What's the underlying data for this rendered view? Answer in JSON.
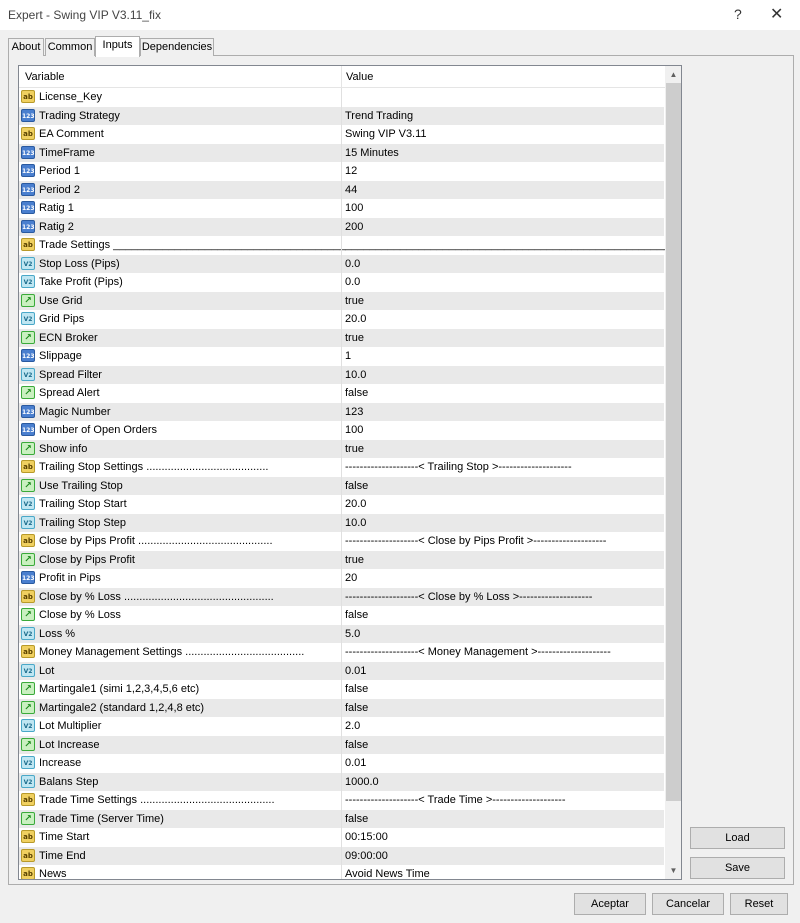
{
  "window": {
    "title": "Expert - Swing VIP V3.11_fix",
    "help": "?",
    "close": "✕"
  },
  "tabs": [
    "About",
    "Common",
    "Inputs",
    "Dependencies"
  ],
  "grid": {
    "headers": {
      "variable": "Variable",
      "value": "Value"
    },
    "rows": [
      {
        "icon": "ab",
        "variable": "License_Key",
        "value": ""
      },
      {
        "icon": "int",
        "variable": "Trading Strategy",
        "value": "Trend Trading"
      },
      {
        "icon": "ab",
        "variable": "EA Comment",
        "value": "Swing VIP V3.11"
      },
      {
        "icon": "int",
        "variable": "TimeFrame",
        "value": "15 Minutes"
      },
      {
        "icon": "int",
        "variable": "Period 1",
        "value": "12"
      },
      {
        "icon": "int",
        "variable": "Period 2",
        "value": "44"
      },
      {
        "icon": "int",
        "variable": "Ratig 1",
        "value": "100"
      },
      {
        "icon": "int",
        "variable": "Ratig 2",
        "value": "200"
      },
      {
        "icon": "ab",
        "variable": "Trade Settings ______________________________________",
        "value": "______________________________________________________"
      },
      {
        "icon": "dbl",
        "variable": "Stop Loss (Pips)",
        "value": "0.0"
      },
      {
        "icon": "dbl",
        "variable": "Take Profit (Pips)",
        "value": "0.0"
      },
      {
        "icon": "bool",
        "variable": "Use Grid",
        "value": "true"
      },
      {
        "icon": "dbl",
        "variable": "Grid Pips",
        "value": "20.0"
      },
      {
        "icon": "bool",
        "variable": "ECN Broker",
        "value": "true"
      },
      {
        "icon": "int",
        "variable": "Slippage",
        "value": "1"
      },
      {
        "icon": "dbl",
        "variable": "Spread Filter",
        "value": "10.0"
      },
      {
        "icon": "bool",
        "variable": "Spread Alert",
        "value": "false"
      },
      {
        "icon": "int",
        "variable": "Magic Number",
        "value": "123"
      },
      {
        "icon": "int",
        "variable": "Number of Open Orders",
        "value": "100"
      },
      {
        "icon": "bool",
        "variable": "Show info",
        "value": "true"
      },
      {
        "icon": "ab",
        "variable": "Trailing Stop Settings ........................................",
        "value": "--------------------< Trailing Stop >--------------------"
      },
      {
        "icon": "bool",
        "variable": "Use Trailing Stop",
        "value": "false"
      },
      {
        "icon": "dbl",
        "variable": "Trailing Stop Start",
        "value": "20.0"
      },
      {
        "icon": "dbl",
        "variable": "Trailing Stop Step",
        "value": "10.0"
      },
      {
        "icon": "ab",
        "variable": "Close by Pips Profit ............................................",
        "value": "--------------------< Close by Pips Profit >--------------------"
      },
      {
        "icon": "bool",
        "variable": "Close by Pips Profit",
        "value": "true"
      },
      {
        "icon": "int",
        "variable": "Profit in Pips",
        "value": "20"
      },
      {
        "icon": "ab",
        "variable": "Close by % Loss .................................................",
        "value": "--------------------< Close by % Loss >--------------------"
      },
      {
        "icon": "bool",
        "variable": "Close by % Loss",
        "value": "false"
      },
      {
        "icon": "dbl",
        "variable": "Loss %",
        "value": "5.0"
      },
      {
        "icon": "ab",
        "variable": "Money Management Settings .......................................",
        "value": "--------------------< Money Management >--------------------"
      },
      {
        "icon": "dbl",
        "variable": "Lot",
        "value": "0.01"
      },
      {
        "icon": "bool",
        "variable": "Martingale1 (simi 1,2,3,4,5,6 etc)",
        "value": "false"
      },
      {
        "icon": "bool",
        "variable": "Martingale2 (standard 1,2,4,8 etc)",
        "value": "false"
      },
      {
        "icon": "dbl",
        "variable": "Lot Multiplier",
        "value": "2.0"
      },
      {
        "icon": "bool",
        "variable": "Lot Increase",
        "value": "false"
      },
      {
        "icon": "dbl",
        "variable": "Increase",
        "value": "0.01"
      },
      {
        "icon": "dbl",
        "variable": "Balans Step",
        "value": "1000.0"
      },
      {
        "icon": "ab",
        "variable": "Trade Time Settings ............................................",
        "value": "--------------------< Trade Time >--------------------"
      },
      {
        "icon": "bool",
        "variable": "Trade Time (Server Time)",
        "value": "false"
      },
      {
        "icon": "ab",
        "variable": "Time Start",
        "value": "00:15:00"
      },
      {
        "icon": "ab",
        "variable": "Time End",
        "value": "09:00:00"
      },
      {
        "icon": "ab",
        "variable": " News",
        "value": "Avoid News Time"
      }
    ],
    "icon_names": {
      "ab": "string-icon",
      "int": "integer-icon",
      "dbl": "double-icon",
      "bool": "bool-icon"
    },
    "icon_glyphs": {
      "ab": "ab",
      "int": "123",
      "dbl": "V2",
      "bool": "↗"
    }
  },
  "side_buttons": {
    "load": "Load",
    "save": "Save"
  },
  "footer_buttons": {
    "accept": "Aceptar",
    "cancel": "Cancelar",
    "reset": "Reset"
  }
}
